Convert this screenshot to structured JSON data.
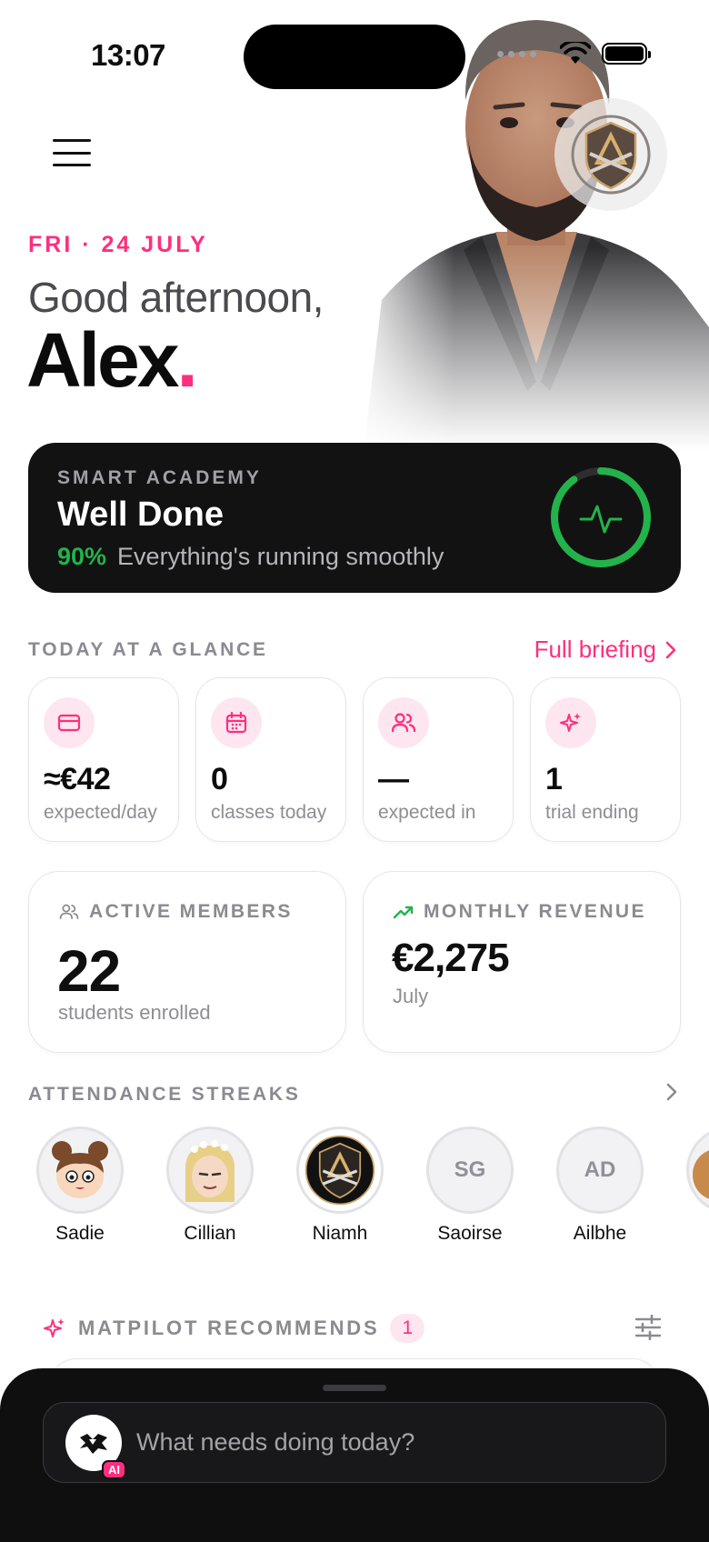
{
  "status_bar": {
    "time": "13:07"
  },
  "hero": {
    "date": "FRI · 24 JULY",
    "greeting": "Good afternoon,",
    "name": "Alex",
    "name_dot": "."
  },
  "health": {
    "eyebrow": "SMART ACADEMY",
    "title": "Well Done",
    "percent": "90%",
    "percent_value": 90,
    "message": "Everything's running smoothly",
    "ring_color": "#22b34b"
  },
  "glance": {
    "label": "TODAY AT A GLANCE",
    "link": "Full briefing",
    "items": [
      {
        "icon": "card-icon",
        "value": "≈€42",
        "caption": "expected/day"
      },
      {
        "icon": "calendar-icon",
        "value": "0",
        "caption": "classes today"
      },
      {
        "icon": "users-icon",
        "value": "—",
        "caption": "expected in"
      },
      {
        "icon": "sparkle-icon",
        "value": "1",
        "caption": "trial ending"
      }
    ]
  },
  "stats": {
    "members": {
      "label": "ACTIVE MEMBERS",
      "value": "22",
      "caption": "students enrolled"
    },
    "revenue": {
      "label": "MONTHLY REVENUE",
      "value": "€2,275",
      "caption": "July"
    }
  },
  "streaks": {
    "label": "ATTENDANCE STREAKS",
    "people": [
      {
        "name": "Sadie",
        "initials": ""
      },
      {
        "name": "Cillian",
        "initials": ""
      },
      {
        "name": "Niamh",
        "initials": ""
      },
      {
        "name": "Saoirse",
        "initials": "SG"
      },
      {
        "name": "Ailbhe",
        "initials": "AD"
      }
    ]
  },
  "recommends": {
    "label": "MATPILOT RECOMMENDS",
    "count": "1"
  },
  "assistant": {
    "placeholder": "What needs doing today?",
    "badge": "AI"
  },
  "colors": {
    "accent": "#ff2e7e",
    "success": "#22b34b",
    "card_dark": "#121212"
  }
}
